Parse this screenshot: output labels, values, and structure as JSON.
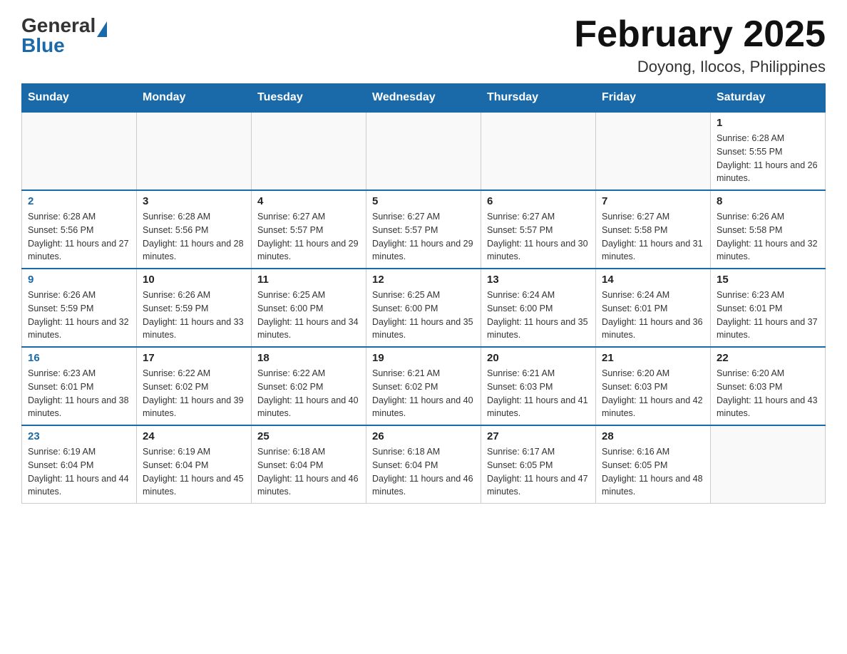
{
  "header": {
    "logo_general": "General",
    "logo_blue": "Blue",
    "title": "February 2025",
    "subtitle": "Doyong, Ilocos, Philippines"
  },
  "calendar": {
    "weekdays": [
      "Sunday",
      "Monday",
      "Tuesday",
      "Wednesday",
      "Thursday",
      "Friday",
      "Saturday"
    ],
    "rows": [
      [
        {
          "day": "",
          "info": ""
        },
        {
          "day": "",
          "info": ""
        },
        {
          "day": "",
          "info": ""
        },
        {
          "day": "",
          "info": ""
        },
        {
          "day": "",
          "info": ""
        },
        {
          "day": "",
          "info": ""
        },
        {
          "day": "1",
          "info": "Sunrise: 6:28 AM\nSunset: 5:55 PM\nDaylight: 11 hours and 26 minutes."
        }
      ],
      [
        {
          "day": "2",
          "info": "Sunrise: 6:28 AM\nSunset: 5:56 PM\nDaylight: 11 hours and 27 minutes."
        },
        {
          "day": "3",
          "info": "Sunrise: 6:28 AM\nSunset: 5:56 PM\nDaylight: 11 hours and 28 minutes."
        },
        {
          "day": "4",
          "info": "Sunrise: 6:27 AM\nSunset: 5:57 PM\nDaylight: 11 hours and 29 minutes."
        },
        {
          "day": "5",
          "info": "Sunrise: 6:27 AM\nSunset: 5:57 PM\nDaylight: 11 hours and 29 minutes."
        },
        {
          "day": "6",
          "info": "Sunrise: 6:27 AM\nSunset: 5:57 PM\nDaylight: 11 hours and 30 minutes."
        },
        {
          "day": "7",
          "info": "Sunrise: 6:27 AM\nSunset: 5:58 PM\nDaylight: 11 hours and 31 minutes."
        },
        {
          "day": "8",
          "info": "Sunrise: 6:26 AM\nSunset: 5:58 PM\nDaylight: 11 hours and 32 minutes."
        }
      ],
      [
        {
          "day": "9",
          "info": "Sunrise: 6:26 AM\nSunset: 5:59 PM\nDaylight: 11 hours and 32 minutes."
        },
        {
          "day": "10",
          "info": "Sunrise: 6:26 AM\nSunset: 5:59 PM\nDaylight: 11 hours and 33 minutes."
        },
        {
          "day": "11",
          "info": "Sunrise: 6:25 AM\nSunset: 6:00 PM\nDaylight: 11 hours and 34 minutes."
        },
        {
          "day": "12",
          "info": "Sunrise: 6:25 AM\nSunset: 6:00 PM\nDaylight: 11 hours and 35 minutes."
        },
        {
          "day": "13",
          "info": "Sunrise: 6:24 AM\nSunset: 6:00 PM\nDaylight: 11 hours and 35 minutes."
        },
        {
          "day": "14",
          "info": "Sunrise: 6:24 AM\nSunset: 6:01 PM\nDaylight: 11 hours and 36 minutes."
        },
        {
          "day": "15",
          "info": "Sunrise: 6:23 AM\nSunset: 6:01 PM\nDaylight: 11 hours and 37 minutes."
        }
      ],
      [
        {
          "day": "16",
          "info": "Sunrise: 6:23 AM\nSunset: 6:01 PM\nDaylight: 11 hours and 38 minutes."
        },
        {
          "day": "17",
          "info": "Sunrise: 6:22 AM\nSunset: 6:02 PM\nDaylight: 11 hours and 39 minutes."
        },
        {
          "day": "18",
          "info": "Sunrise: 6:22 AM\nSunset: 6:02 PM\nDaylight: 11 hours and 40 minutes."
        },
        {
          "day": "19",
          "info": "Sunrise: 6:21 AM\nSunset: 6:02 PM\nDaylight: 11 hours and 40 minutes."
        },
        {
          "day": "20",
          "info": "Sunrise: 6:21 AM\nSunset: 6:03 PM\nDaylight: 11 hours and 41 minutes."
        },
        {
          "day": "21",
          "info": "Sunrise: 6:20 AM\nSunset: 6:03 PM\nDaylight: 11 hours and 42 minutes."
        },
        {
          "day": "22",
          "info": "Sunrise: 6:20 AM\nSunset: 6:03 PM\nDaylight: 11 hours and 43 minutes."
        }
      ],
      [
        {
          "day": "23",
          "info": "Sunrise: 6:19 AM\nSunset: 6:04 PM\nDaylight: 11 hours and 44 minutes."
        },
        {
          "day": "24",
          "info": "Sunrise: 6:19 AM\nSunset: 6:04 PM\nDaylight: 11 hours and 45 minutes."
        },
        {
          "day": "25",
          "info": "Sunrise: 6:18 AM\nSunset: 6:04 PM\nDaylight: 11 hours and 46 minutes."
        },
        {
          "day": "26",
          "info": "Sunrise: 6:18 AM\nSunset: 6:04 PM\nDaylight: 11 hours and 46 minutes."
        },
        {
          "day": "27",
          "info": "Sunrise: 6:17 AM\nSunset: 6:05 PM\nDaylight: 11 hours and 47 minutes."
        },
        {
          "day": "28",
          "info": "Sunrise: 6:16 AM\nSunset: 6:05 PM\nDaylight: 11 hours and 48 minutes."
        },
        {
          "day": "",
          "info": ""
        }
      ]
    ]
  }
}
